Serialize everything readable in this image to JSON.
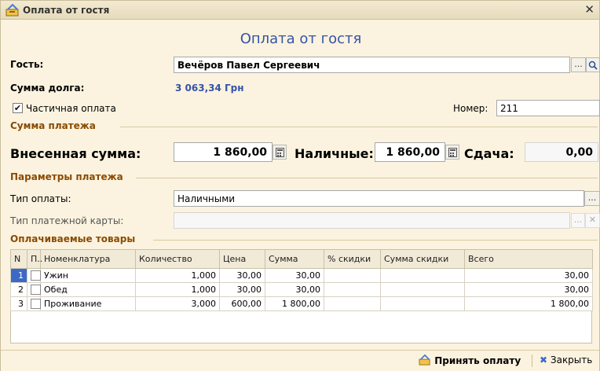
{
  "window": {
    "title": "Оплата от гостя",
    "close_glyph": "✕"
  },
  "heading": "Оплата от гостя",
  "guest": {
    "label": "Гость:",
    "value": "Вечёров Павел Сергеевич",
    "select_btn": "...",
    "search_icon": "search-icon"
  },
  "debt": {
    "label": "Сумма долга:",
    "value": "3 063,34 Грн",
    "color": "#3553a8"
  },
  "partial": {
    "label": "Частичная оплата",
    "checked": true
  },
  "number": {
    "label": "Номер:",
    "value": "211"
  },
  "payment_section": {
    "title": "Сумма платежа"
  },
  "deposited": {
    "label": "Внесенная сумма:",
    "value": "1 860,00"
  },
  "cash": {
    "label": "Наличные:",
    "value": "1 860,00"
  },
  "change": {
    "label": "Сдача:",
    "value": "0,00"
  },
  "params_section": {
    "title": "Параметры платежа"
  },
  "pay_type": {
    "label": "Тип оплаты:",
    "value": "Наличными",
    "select_btn": "..."
  },
  "card_type": {
    "label": "Тип платежной карты:",
    "value": "",
    "select_btn": "...",
    "clear_btn": "✕"
  },
  "goods_section": {
    "title": "Оплачиваемые товары"
  },
  "table": {
    "headers": [
      "N",
      "П..",
      "Номенклатура",
      "Количество",
      "Цена",
      "Сумма",
      "% скидки",
      "Сумма скидки",
      "Всего"
    ],
    "rows": [
      {
        "n": "1",
        "name": "Ужин",
        "qty": "1,000",
        "price": "30,00",
        "sum": "30,00",
        "disc": "",
        "disc_sum": "",
        "total": "30,00"
      },
      {
        "n": "2",
        "name": "Обед",
        "qty": "1,000",
        "price": "30,00",
        "sum": "30,00",
        "disc": "",
        "disc_sum": "",
        "total": "30,00"
      },
      {
        "n": "3",
        "name": "Проживание",
        "qty": "3,000",
        "price": "600,00",
        "sum": "1 800,00",
        "disc": "",
        "disc_sum": "",
        "total": "1 800,00"
      }
    ]
  },
  "footer": {
    "accept": "Принять оплату",
    "close": "Закрыть"
  }
}
